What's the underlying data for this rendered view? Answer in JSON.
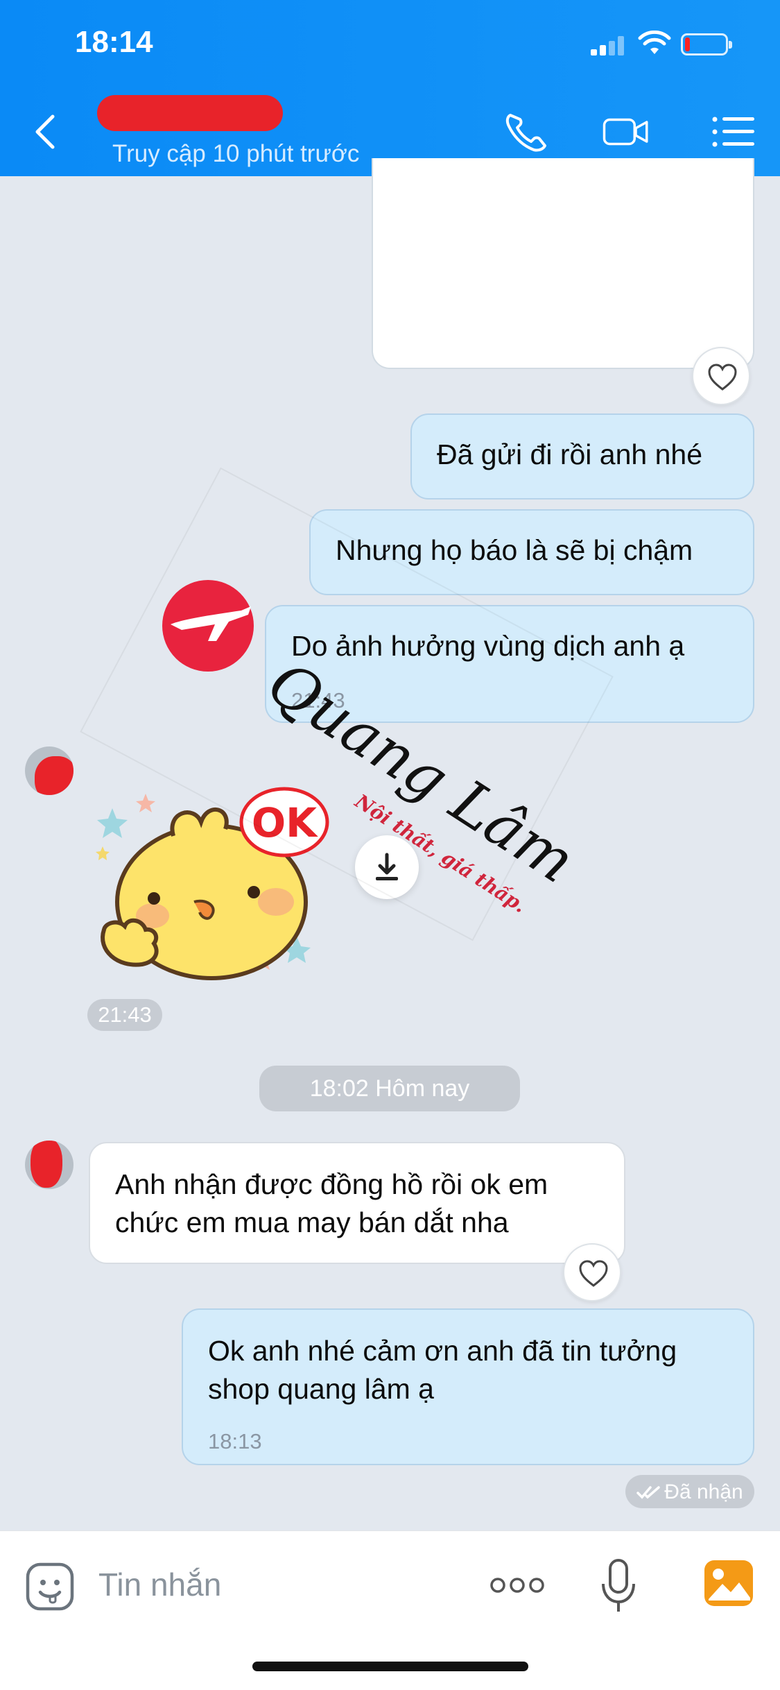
{
  "status_bar": {
    "time": "18:14"
  },
  "header": {
    "last_seen": "Truy cập 10 phút trước",
    "icons": [
      "back-icon",
      "phone-icon",
      "video-call-icon",
      "menu-list-icon"
    ]
  },
  "messages": [
    {
      "side": "me",
      "text": "Đã gửi đi rồi anh nhé"
    },
    {
      "side": "me",
      "text": "Nhưng họ báo là sẽ bị chậm"
    },
    {
      "side": "me",
      "text": "Do ảnh hưởng vùng dịch anh ạ",
      "time": "21:43"
    },
    {
      "side": "them",
      "type": "sticker",
      "sticker_text": "OK",
      "time": "21:43"
    },
    {
      "side": "them",
      "text": "Anh nhận được đồng hồ rồi ok em\nchức em mua may bán dắt nha"
    },
    {
      "side": "me",
      "text": "Ok anh nhé cảm ơn anh đã tin tưởng\nshop quang lâm ạ",
      "time": "18:13"
    }
  ],
  "date_separator": "18:02 Hôm nay",
  "delivery_status": "Đã nhận",
  "input": {
    "placeholder": "Tin nhắn"
  },
  "watermark": {
    "brand": "Quang Lâm",
    "tagline": "Nội thất, giá thấp."
  },
  "colors": {
    "header": "#0a8af6",
    "my_bubble": "#d4ecfb",
    "their_bubble": "#ffffff",
    "background": "#e3e8ef"
  }
}
